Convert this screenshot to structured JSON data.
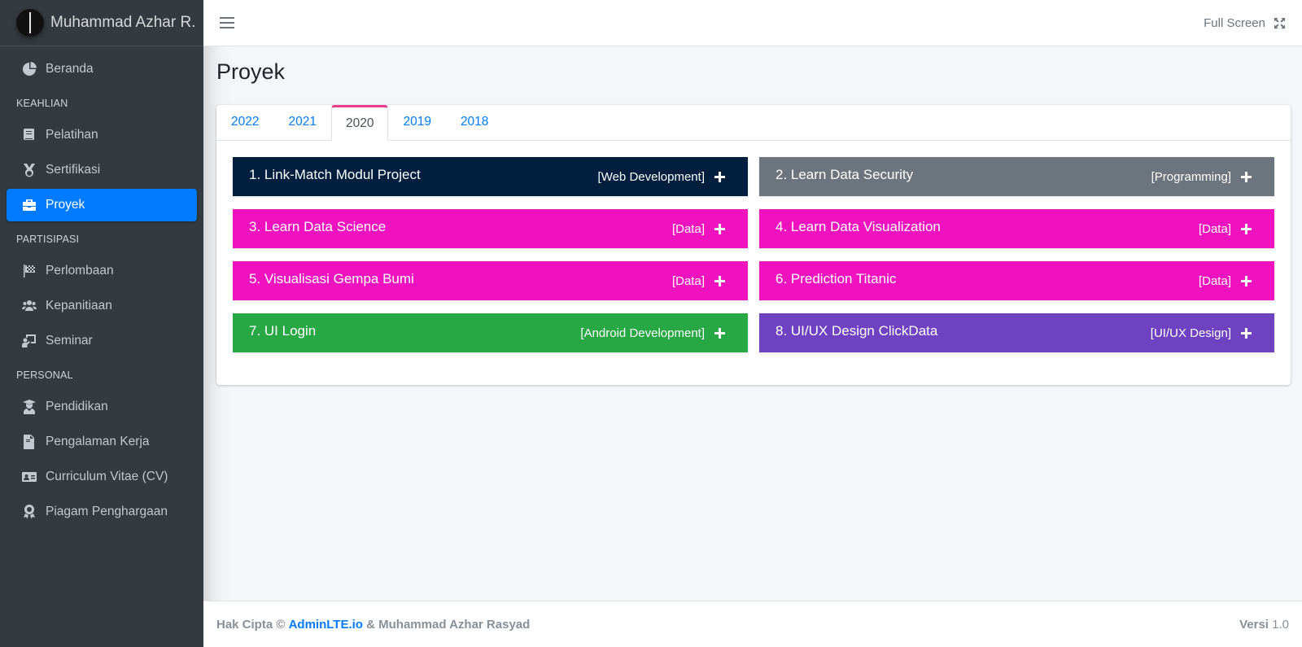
{
  "brand": {
    "name": "Muhammad Azhar R."
  },
  "sidebar": {
    "items": [
      {
        "label": "Beranda",
        "icon": "chart-pie-icon"
      },
      {
        "header": "KEAHLIAN"
      },
      {
        "label": "Pelatihan",
        "icon": "book-icon"
      },
      {
        "label": "Sertifikasi",
        "icon": "medal-icon"
      },
      {
        "label": "Proyek",
        "icon": "briefcase-icon",
        "active": true
      },
      {
        "header": "PARTISIPASI"
      },
      {
        "label": "Perlombaan",
        "icon": "flag-checkered-icon"
      },
      {
        "label": "Kepanitiaan",
        "icon": "users-icon"
      },
      {
        "label": "Seminar",
        "icon": "chalkboard-teacher-icon"
      },
      {
        "header": "PERSONAL"
      },
      {
        "label": "Pendidikan",
        "icon": "user-graduate-icon"
      },
      {
        "label": "Pengalaman Kerja",
        "icon": "file-contract-icon"
      },
      {
        "label": "Curriculum Vitae (CV)",
        "icon": "id-card-icon"
      },
      {
        "label": "Piagam Penghargaan",
        "icon": "award-icon"
      }
    ]
  },
  "topbar": {
    "fullscreen_label": "Full Screen"
  },
  "page": {
    "title": "Proyek"
  },
  "tabs": [
    {
      "label": "2022"
    },
    {
      "label": "2021"
    },
    {
      "label": "2020",
      "active": true
    },
    {
      "label": "2019"
    },
    {
      "label": "2018"
    }
  ],
  "projects": [
    {
      "title": "1. Link-Match Modul Project",
      "category": "[Web Development]",
      "color": "#001f3f"
    },
    {
      "title": "2. Learn Data Security",
      "category": "[Programming]",
      "color": "#6c757d"
    },
    {
      "title": "3. Learn Data Science",
      "category": "[Data]",
      "color": "#f012be"
    },
    {
      "title": "4. Learn Data Visualization",
      "category": "[Data]",
      "color": "#f012be"
    },
    {
      "title": "5. Visualisasi Gempa Bumi",
      "category": "[Data]",
      "color": "#f012be"
    },
    {
      "title": "6. Prediction Titanic",
      "category": "[Data]",
      "color": "#f012be"
    },
    {
      "title": "7. UI Login",
      "category": "[Android Development]",
      "color": "#28a745"
    },
    {
      "title": "8. UI/UX Design ClickData",
      "category": "[UI/UX Design]",
      "color": "#6f42c1"
    }
  ],
  "footer": {
    "prefix": "Hak Cipta ©",
    "link": "AdminLTE.io",
    "suffix": "& Muhammad Azhar Rasyad",
    "version_label": "Versi",
    "version": "1.0"
  }
}
